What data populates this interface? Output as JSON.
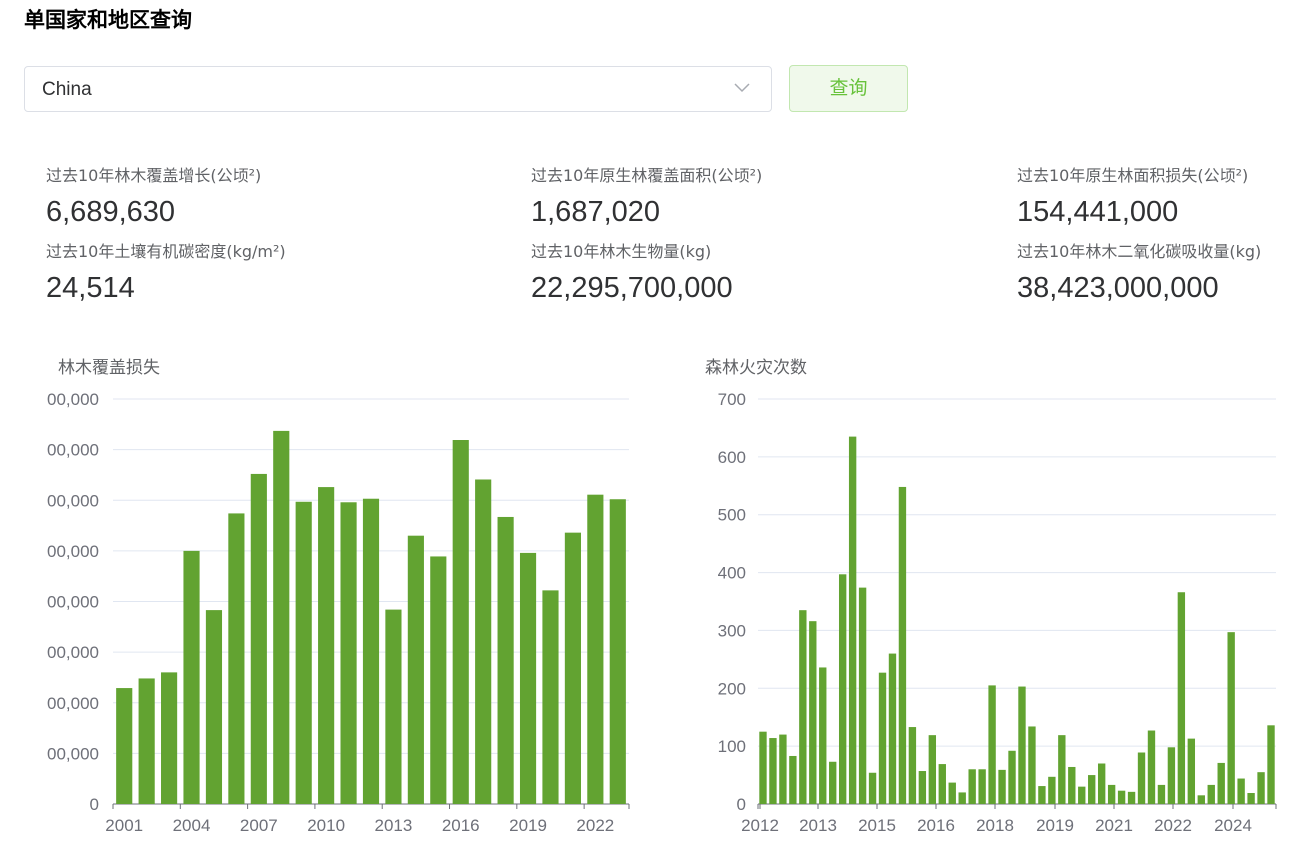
{
  "page": {
    "title": "单国家和地区查询"
  },
  "query": {
    "selected_country": "China",
    "button_label": "查询"
  },
  "stats": [
    {
      "label": "过去10年林木覆盖增长(公顷²)",
      "value": "6,689,630"
    },
    {
      "label": "过去10年原生林覆盖面积(公顷²)",
      "value": "1,687,020"
    },
    {
      "label": "过去10年原生林面积损失(公顷²)",
      "value": "154,441,000"
    },
    {
      "label": "过去10年土壤有机碳密度(kg/m²)",
      "value": "24,514"
    },
    {
      "label": "过去10年林木生物量(kg)",
      "value": "22,295,700,000"
    },
    {
      "label": "过去10年林木二氧化碳吸收量(kg)",
      "value": "38,423,000,000"
    }
  ],
  "colors": {
    "bar": "#62a331",
    "grid": "#e0e6f1",
    "axis": "#6e7079",
    "accent": "#67c23a"
  },
  "chart_data": [
    {
      "type": "bar",
      "title": "林木覆盖损失",
      "ytick_labels": [
        "0",
        "00,000",
        "00,000",
        "00,000",
        "00,000",
        "00,000",
        "00,000",
        "00,000",
        "00,000"
      ],
      "ytick_values": [
        0,
        1,
        2,
        3,
        4,
        5,
        6,
        7,
        8
      ],
      "ylim": [
        0,
        8
      ],
      "x_labels": [
        "2001",
        "2004",
        "2007",
        "2010",
        "2013",
        "2016",
        "2019",
        "2022"
      ],
      "x": [
        2001,
        2002,
        2003,
        2004,
        2005,
        2006,
        2007,
        2008,
        2009,
        2010,
        2011,
        2012,
        2013,
        2014,
        2015,
        2016,
        2017,
        2018,
        2019,
        2020,
        2021,
        2022,
        2023
      ],
      "values": [
        2.29,
        2.48,
        2.6,
        5.0,
        3.83,
        5.74,
        6.52,
        7.37,
        5.97,
        6.26,
        5.96,
        6.03,
        3.84,
        5.3,
        4.89,
        7.19,
        6.41,
        5.67,
        4.96,
        4.22,
        5.36,
        6.11,
        6.02
      ],
      "grid": true
    },
    {
      "type": "bar",
      "title": "森林火灾次数",
      "ytick_labels": [
        "0",
        "100",
        "200",
        "300",
        "400",
        "500",
        "600",
        "700"
      ],
      "ytick_values": [
        0,
        100,
        200,
        300,
        400,
        500,
        600,
        700
      ],
      "ylim": [
        0,
        700
      ],
      "x_labels": [
        "2012",
        "2013",
        "2015",
        "2016",
        "2018",
        "2019",
        "2021",
        "2022",
        "2024"
      ],
      "values": [
        125,
        114,
        120,
        83,
        335,
        316,
        236,
        73,
        397,
        635,
        374,
        54,
        227,
        260,
        548,
        133,
        57,
        119,
        69,
        37,
        20,
        60,
        60,
        205,
        59,
        92,
        203,
        134,
        31,
        47,
        119,
        64,
        30,
        50,
        70,
        33,
        23,
        21,
        89,
        127,
        33,
        98,
        366,
        113,
        15,
        33,
        71,
        297,
        44,
        19,
        55,
        136
      ],
      "grid": true
    }
  ]
}
